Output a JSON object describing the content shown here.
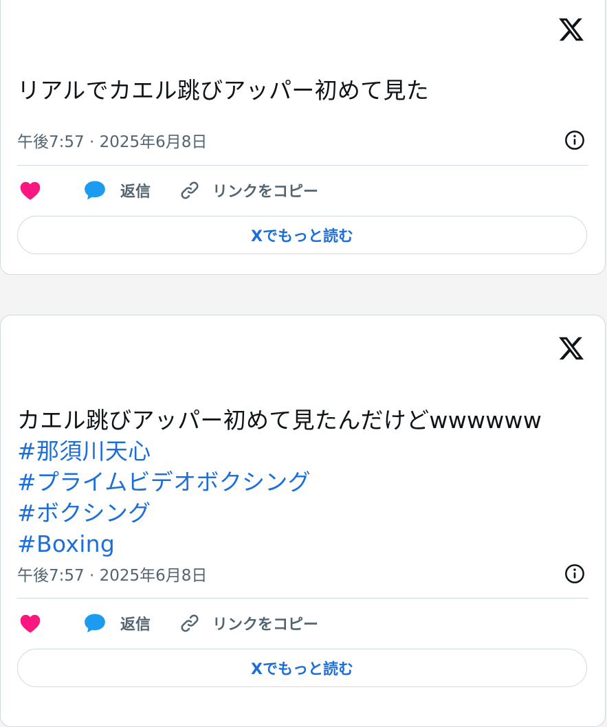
{
  "colors": {
    "accent": "#1d6fd8",
    "heart": "#f91880",
    "reply_bubble": "#1d9bf0",
    "muted_text": "#536471",
    "border": "#cfd9de"
  },
  "tweets": [
    {
      "text": "リアルでカエル跳びアッパー初めて見た",
      "hashtags": [],
      "timestamp": "午後7:57 · 2025年6月8日",
      "reply_label": "返信",
      "copy_link_label": "リンクをコピー",
      "read_more_label": "Xでもっと読む",
      "icons": [
        "x-logo-icon",
        "info-icon",
        "heart-icon",
        "speech-bubble-icon",
        "link-icon"
      ]
    },
    {
      "text": "カエル跳びアッパー初めて見たんだけどwwwwww",
      "hashtags": [
        "#那須川天心",
        "#プライムビデオボクシング",
        "#ボクシング",
        "#Boxing"
      ],
      "timestamp": "午後7:57 · 2025年6月8日",
      "reply_label": "返信",
      "copy_link_label": "リンクをコピー",
      "read_more_label": "Xでもっと読む",
      "icons": [
        "x-logo-icon",
        "info-icon",
        "heart-icon",
        "speech-bubble-icon",
        "link-icon"
      ]
    }
  ]
}
